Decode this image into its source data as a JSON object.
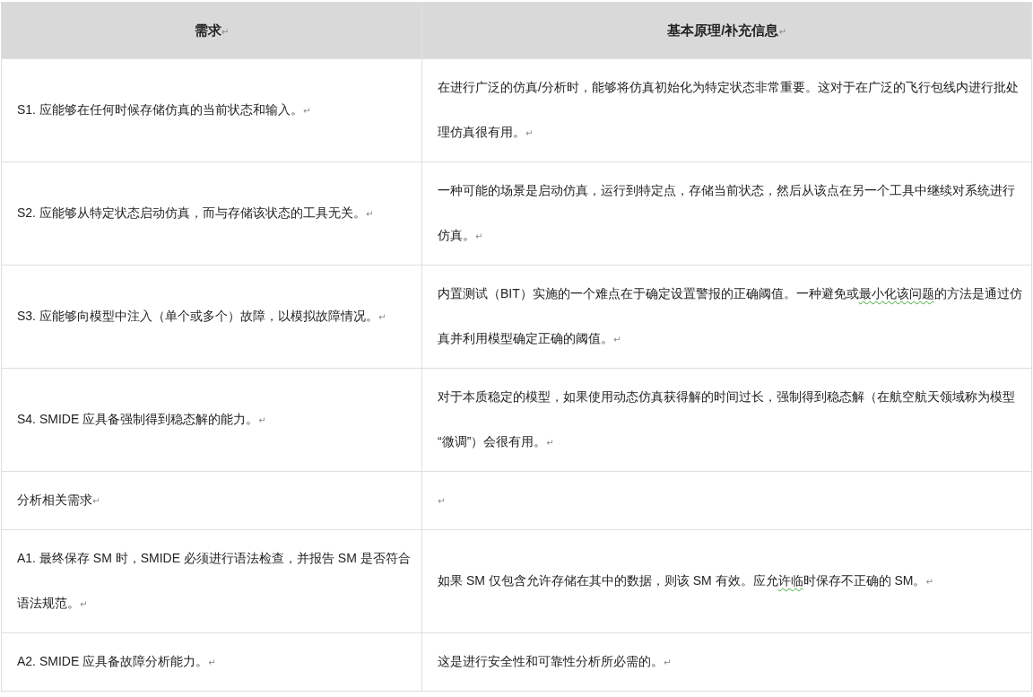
{
  "table": {
    "columns": [
      {
        "label": "需求",
        "mark": "↵"
      },
      {
        "label": "基本原理/补充信息",
        "mark": "↵"
      }
    ],
    "rows": [
      {
        "cells": [
          {
            "segments": [
              {
                "text": "S1.  应能够在任何时候存储仿真的当前状态和输入。",
                "flagged": false
              }
            ],
            "mark": "↵"
          },
          {
            "segments": [
              {
                "text": "在进行广泛的仿真/分析时，能够将仿真初始化为特定状态非常重要。这对于在广泛的飞行包线内进行批处理仿真很有用。",
                "flagged": false
              }
            ],
            "mark": "↵"
          }
        ]
      },
      {
        "cells": [
          {
            "segments": [
              {
                "text": "S2.  应能够从特定状态启动仿真，而与存储该状态的工具无关。",
                "flagged": false
              }
            ],
            "mark": "↵"
          },
          {
            "segments": [
              {
                "text": "一种可能的场景是启动仿真，运行到特定点，存储当前状态，然后从该点在另一个工具中继续对系统进行仿真。",
                "flagged": false
              }
            ],
            "mark": "↵"
          }
        ]
      },
      {
        "cells": [
          {
            "segments": [
              {
                "text": "S3.  应能够向模型中注入（单个或多个）故障，以模拟故障情况。",
                "flagged": false
              }
            ],
            "mark": "↵"
          },
          {
            "segments": [
              {
                "text": "内置测试（BIT）实施的一个难点在于确定设置警报的正确阈值。一种避免或",
                "flagged": false
              },
              {
                "text": "最小化该问题",
                "flagged": true
              },
              {
                "text": "的方法是通过仿真并利用模型确定正确的阈值。",
                "flagged": false
              }
            ],
            "mark": "↵"
          }
        ]
      },
      {
        "cells": [
          {
            "segments": [
              {
                "text": "S4. SMIDE 应具备强制得到稳态解的能力。",
                "flagged": false
              }
            ],
            "mark": "↵"
          },
          {
            "segments": [
              {
                "text": "对于本质稳定的模型，如果使用动态仿真获得解的时间过长，强制得到稳态解（在航空航天领域称为模型 “微调”）会很有用。",
                "flagged": false
              }
            ],
            "mark": "↵"
          }
        ]
      },
      {
        "cells": [
          {
            "segments": [
              {
                "text": "分析相关需求",
                "flagged": false
              }
            ],
            "mark": "↵"
          },
          {
            "mark": "↵"
          }
        ]
      },
      {
        "cells": [
          {
            "segments": [
              {
                "text": "A1.  最终保存 SM 时，SMIDE 必须进行语法检查，并报告 SM 是否符合语法规范。",
                "flagged": false
              }
            ],
            "mark": "↵"
          },
          {
            "segments": [
              {
                "text": "如果 SM 仅包含允许存储在其中的数据，则该 SM 有效。应允",
                "flagged": false
              },
              {
                "text": "许临",
                "flagged": true
              },
              {
                "text": "时保存不正确的 SM。",
                "flagged": false
              }
            ],
            "mark": "↵"
          }
        ]
      },
      {
        "cells": [
          {
            "segments": [
              {
                "text": "A2. SMIDE 应具备故障分析能力。",
                "flagged": false
              }
            ],
            "mark": "↵"
          },
          {
            "segments": [
              {
                "text": "这是进行安全性和可靠性分析所必需的。",
                "flagged": false
              }
            ],
            "mark": "↵"
          }
        ]
      }
    ]
  }
}
